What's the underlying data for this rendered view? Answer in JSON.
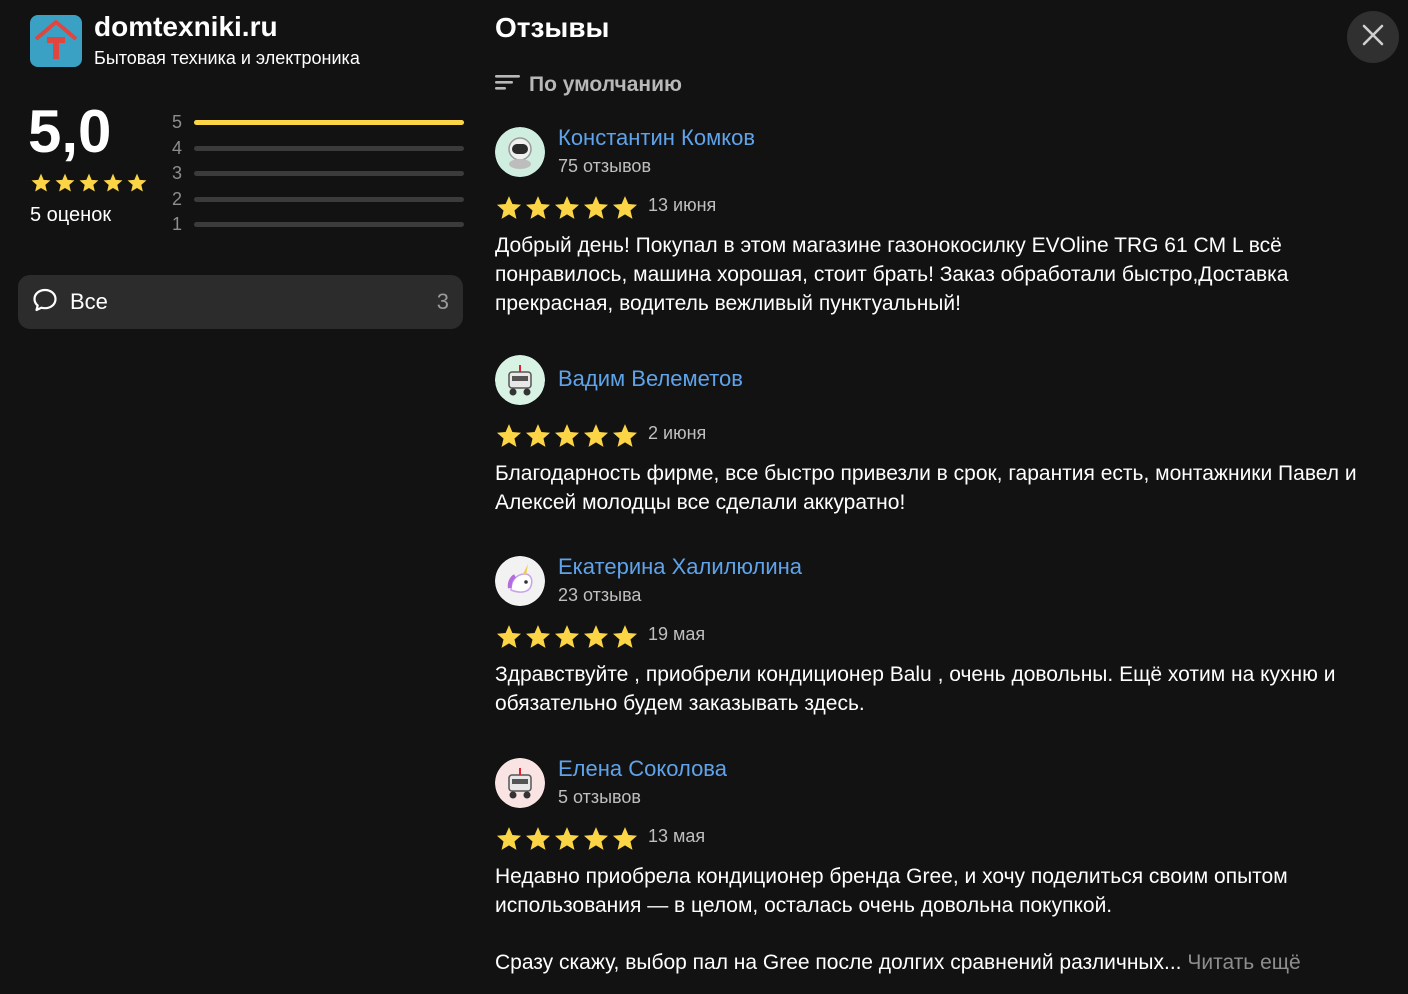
{
  "org": {
    "name": "domtexniki.ru",
    "subtitle": "Бытовая техника и электроника",
    "logo_letter": "Т"
  },
  "rating": {
    "value": "5,0",
    "stars": 5,
    "count_label": "5 оценок",
    "distribution": [
      {
        "label": "5",
        "fraction": 1.0
      },
      {
        "label": "4",
        "fraction": 0.0
      },
      {
        "label": "3",
        "fraction": 0.0
      },
      {
        "label": "2",
        "fraction": 0.0
      },
      {
        "label": "1",
        "fraction": 0.0
      }
    ]
  },
  "filter": {
    "label": "Все",
    "count": "3",
    "icon": "chat-bubble-icon"
  },
  "reviews_panel": {
    "title": "Отзывы",
    "sort_label": "По умолчанию",
    "sort_icon": "sort-icon",
    "close_icon": "close-icon"
  },
  "reviews": [
    {
      "author": "Константин Комков",
      "author_reviews": "75 отзывов",
      "stars": 5,
      "date": "13 июня",
      "text": "Добрый день! Покупал в этом магазине газонокосилку EVOline TRG 61 CM L всё понравилось, машина хорошая, стоит брать! Заказ обработали быстро,Доставка прекрасная, водитель вежливый пунктуальный!",
      "avatar_icon": "astronaut-icon"
    },
    {
      "author": "Вадим Велеметов",
      "author_reviews": "",
      "stars": 5,
      "date": "2 июня",
      "text": "Благодарность фирме, все быстро привезли в срок, гарантия есть, монтажники Павел и Алексей молодцы все сделали аккуратно!",
      "avatar_icon": "robot-icon"
    },
    {
      "author": "Екатерина Халилюлина",
      "author_reviews": "23 отзыва",
      "stars": 5,
      "date": "19 мая",
      "text": "Здравствуйте , приобрели кондиционер Balu , очень довольны. Ещё хотим на кухню и обязательно будем заказывать здесь.",
      "avatar_icon": "unicorn-icon"
    },
    {
      "author": "Елена Соколова",
      "author_reviews": "5 отзывов",
      "stars": 5,
      "date": "13 мая",
      "text": "Недавно приобрела кондиционер бренда Gree, и хочу поделиться своим опытом использования — в целом, осталась очень довольна покупкой.",
      "text2": "Сразу скажу, выбор пал на Gree после долгих сравнений различных...",
      "read_more": " Читать ещё",
      "avatar_icon": "robot-icon"
    }
  ],
  "colors": {
    "background": "#121212",
    "star": "#fcd547",
    "author_link": "#5fa3ea",
    "logo_bg": "#3aa1c4",
    "logo_mark": "#e0463f"
  }
}
